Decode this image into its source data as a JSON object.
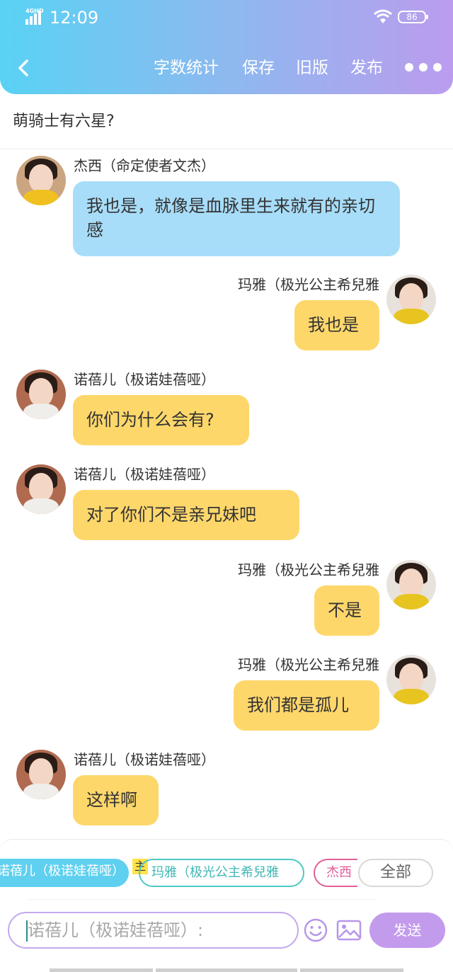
{
  "status_bar": {
    "network": "4GHD",
    "time": "12:09",
    "battery": "86"
  },
  "header": {
    "actions": [
      "字数统计",
      "保存",
      "旧版",
      "发布"
    ]
  },
  "topic": "萌骑士有六星?",
  "messages": [
    {
      "side": "left",
      "name": "杰西（命定使者文杰）",
      "text": "我也是，就像是血脉里生来就有的亲切感",
      "color": "blue"
    },
    {
      "side": "right",
      "name": "玛雅（极光公主希兒雅",
      "text": "我也是",
      "color": "yellow"
    },
    {
      "side": "left",
      "name": "诺蓓儿（极诺娃蓓哑）",
      "text": "你们为什么会有?",
      "color": "yellow"
    },
    {
      "side": "left",
      "name": "诺蓓儿（极诺娃蓓哑）",
      "text": "对了你们不是亲兄妹吧",
      "color": "yellow"
    },
    {
      "side": "right",
      "name": "玛雅（极光公主希兒雅",
      "text": "不是",
      "color": "yellow"
    },
    {
      "side": "right",
      "name": "玛雅（极光公主希兒雅",
      "text": "我们都是孤儿",
      "color": "yellow"
    },
    {
      "side": "left",
      "name": "诺蓓儿（极诺娃蓓哑）",
      "text": "这样啊",
      "color": "yellow"
    }
  ],
  "role_bar": {
    "active": "诺蓓儿（极诺娃蓓哑）",
    "host_badge": "主",
    "roles": [
      "玛雅（极光公主希兒雅",
      "杰西"
    ],
    "all_label": "全部"
  },
  "composer": {
    "placeholder": "诺蓓儿（极诺娃蓓哑）:",
    "send_label": "发送"
  },
  "colors": {
    "header_gradient": [
      "#59d2f4",
      "#bb9cee"
    ],
    "bubble_blue": "#a8ddf9",
    "bubble_yellow": "#fed76b",
    "send_button": "#c39bec"
  }
}
